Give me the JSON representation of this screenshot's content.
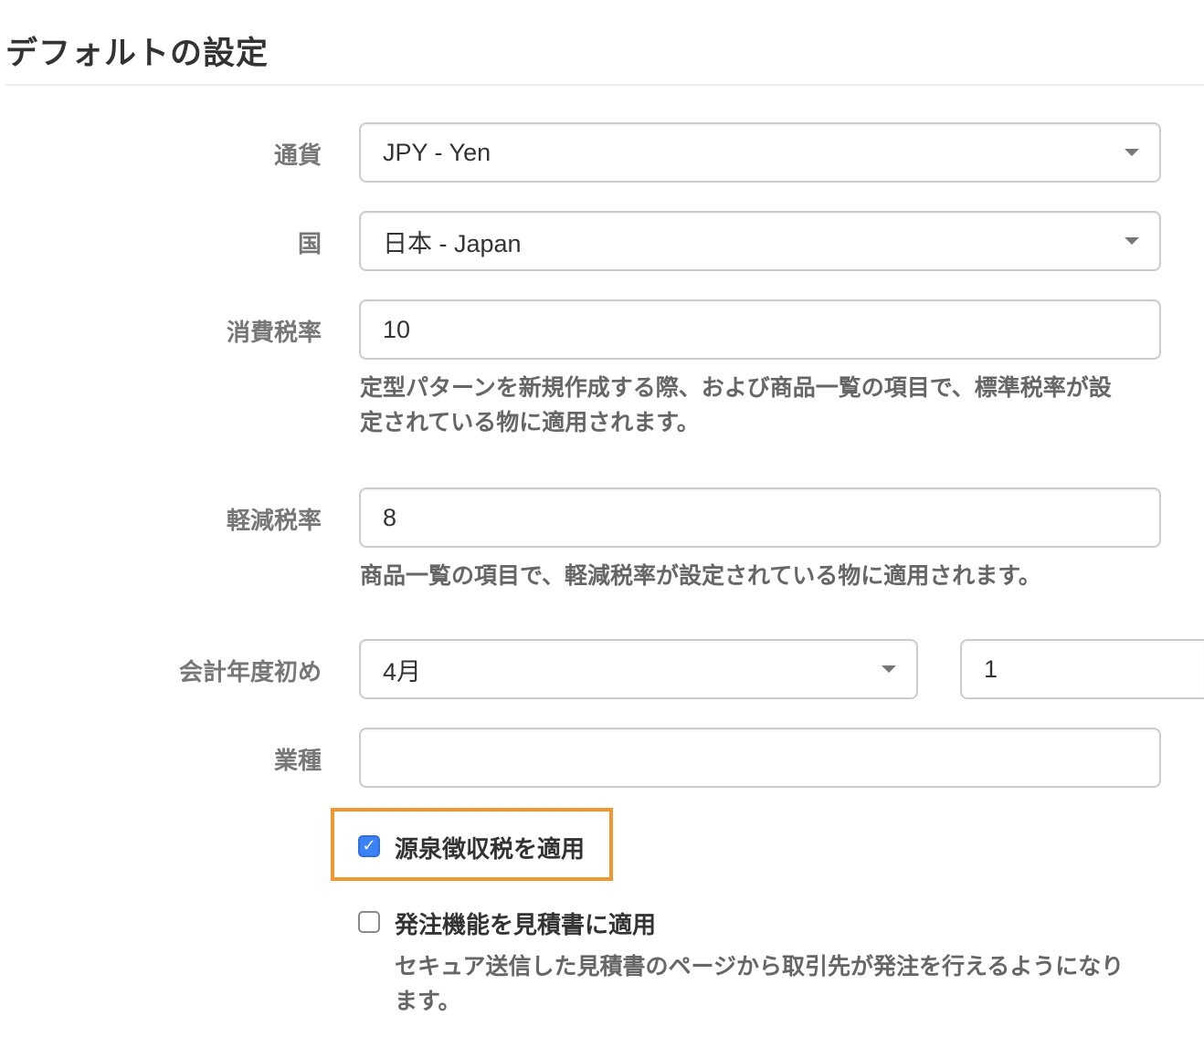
{
  "section": {
    "title": "デフォルトの設定"
  },
  "currency": {
    "label": "通貨",
    "value": "JPY - Yen"
  },
  "country": {
    "label": "国",
    "value": "日本 - Japan"
  },
  "consumption_tax": {
    "label": "消費税率",
    "value": "10",
    "help_line1": "定型パターンを新規作成する際、および商品一覧の項目で、標準税率が設",
    "help_line2": "定されている物に適用されます。"
  },
  "reduced_tax": {
    "label": "軽減税率",
    "value": "8",
    "help": "商品一覧の項目で、軽減税率が設定されている物に適用されます。"
  },
  "fiscal_year_start": {
    "label": "会計年度初め",
    "month": "4月",
    "day": "1"
  },
  "industry": {
    "label": "業種",
    "value": ""
  },
  "withholding_tax": {
    "label": "源泉徴収税を適用",
    "checked": true,
    "check_glyph": "✓"
  },
  "order_feature": {
    "label": "発注機能を見積書に適用",
    "checked": false,
    "help_line1": "セキュア送信した見積書のページから取引先が発注を行えるようになり",
    "help_line2": "ます。"
  },
  "colors": {
    "accent": "#3b82f6",
    "highlight": "#f0982f",
    "label_text": "#777777"
  }
}
